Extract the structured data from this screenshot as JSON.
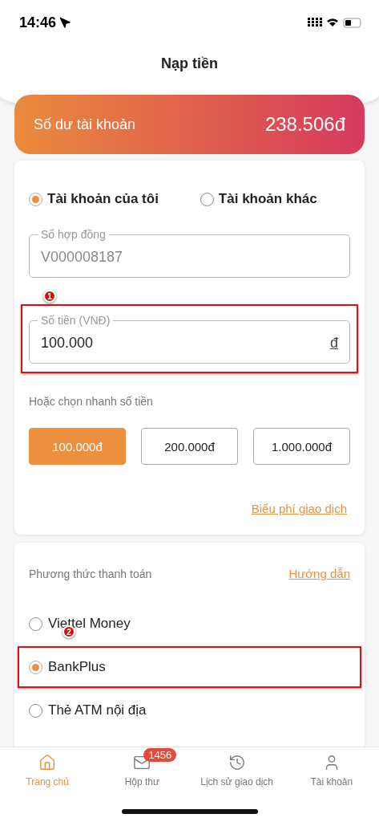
{
  "status_bar": {
    "time": "14:46"
  },
  "header": {
    "title": "Nạp tiền"
  },
  "balance": {
    "label": "Số dư tài khoản",
    "amount": "238.506đ"
  },
  "account_types": [
    {
      "label": "Tài khoản của tôi",
      "selected": true
    },
    {
      "label": "Tài khoản khác",
      "selected": false
    }
  ],
  "contract_field": {
    "label": "Số hợp đồng",
    "value": "V000008187"
  },
  "amount_field": {
    "label": "Số tiền (VNĐ)",
    "value": "100.000",
    "unit": "đ",
    "annotation": "1"
  },
  "quick_amounts": {
    "label": "Hoặc chọn nhanh số tiền",
    "options": [
      {
        "label": "100.000đ",
        "selected": true
      },
      {
        "label": "200.000đ",
        "selected": false
      },
      {
        "label": "1.000.000đ",
        "selected": false
      }
    ]
  },
  "fee_link": "Biểu phí giao dịch",
  "payment": {
    "title": "Phương thức thanh toán",
    "guide_link": "Hướng dẫn",
    "methods": [
      {
        "label": "Viettel Money",
        "selected": false
      },
      {
        "label": "BankPlus",
        "selected": true,
        "annotation": "2"
      },
      {
        "label": "Thẻ ATM nội địa",
        "selected": false
      }
    ]
  },
  "tab_bar": [
    {
      "label": "Trang chủ",
      "kind": "home",
      "selected": true
    },
    {
      "label": "Hộp thư",
      "kind": "mail",
      "selected": false,
      "badge": "1456"
    },
    {
      "label": "Lịch sử giao dịch",
      "kind": "history",
      "selected": false
    },
    {
      "label": "Tài khoản",
      "kind": "user",
      "selected": false
    }
  ]
}
